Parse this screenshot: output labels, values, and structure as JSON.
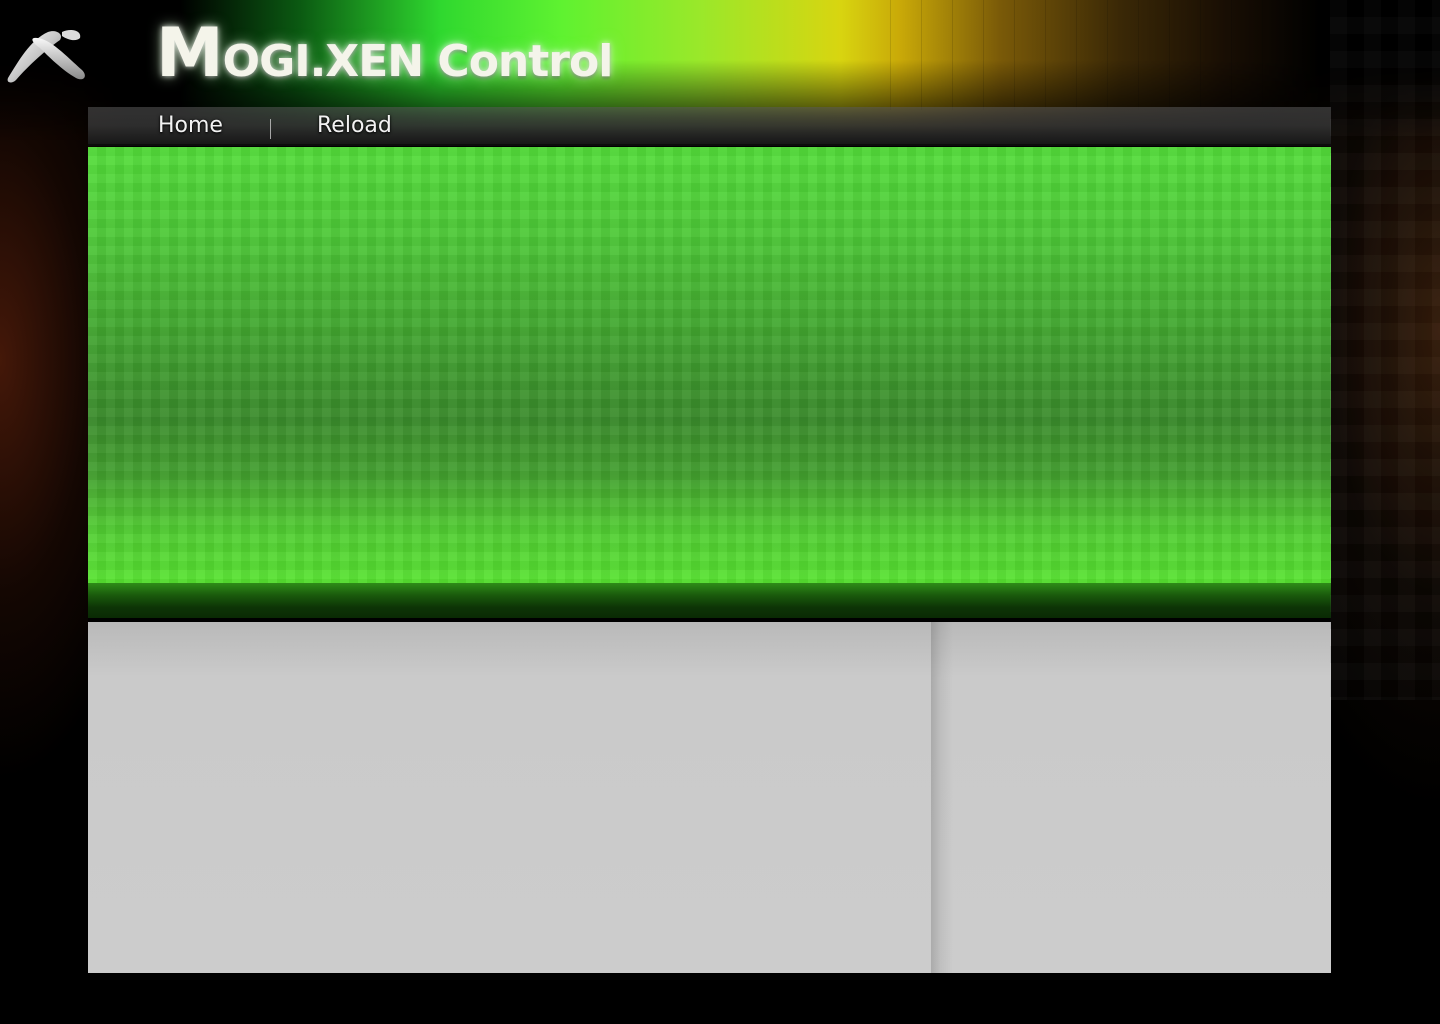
{
  "header": {
    "title_initial": "M",
    "title_rest": "OGI.XEN Control",
    "logo_icon": "mogixen-logo-icon"
  },
  "nav": {
    "items": [
      {
        "label": "Home"
      },
      {
        "label": "Reload"
      }
    ]
  },
  "colors": {
    "banner_green": "#4cc637",
    "content_gray": "#cccccc",
    "background": "#000000"
  }
}
